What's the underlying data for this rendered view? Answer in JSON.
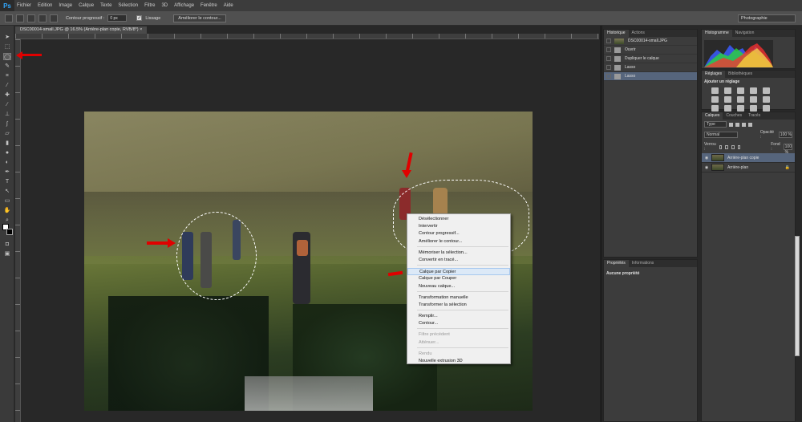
{
  "app": {
    "logo": "Ps"
  },
  "menu": [
    "Fichier",
    "Edition",
    "Image",
    "Calque",
    "Texte",
    "Sélection",
    "Filtre",
    "3D",
    "Affichage",
    "Fenêtre",
    "Aide"
  ],
  "options": {
    "feather_label": "Contour progressif :",
    "feather_value": "0 px",
    "antialias_label": "Lissage",
    "refine_button": "Améliorer le contour...",
    "workspace": "Photographie"
  },
  "document": {
    "tab_title": "DSC00014-small.JPG @ 16.5% (Arrière-plan copie, RVB/8*) ×"
  },
  "context_menu": {
    "items": [
      {
        "label": "Désélectionner",
        "state": "normal"
      },
      {
        "label": "Intervertir",
        "state": "normal"
      },
      {
        "label": "Contour progressif...",
        "state": "normal"
      },
      {
        "label": "Améliorer le contour...",
        "state": "normal"
      },
      {
        "sep": true
      },
      {
        "label": "Mémoriser la sélection...",
        "state": "normal"
      },
      {
        "label": "Convertir en tracé...",
        "state": "normal"
      },
      {
        "sep": true
      },
      {
        "label": "Calque par Copier",
        "state": "highlighted"
      },
      {
        "label": "Calque par Couper",
        "state": "normal"
      },
      {
        "label": "Nouveau calque...",
        "state": "normal"
      },
      {
        "sep": true
      },
      {
        "label": "Transformation manuelle",
        "state": "normal"
      },
      {
        "label": "Transformer la sélection",
        "state": "normal"
      },
      {
        "sep": true
      },
      {
        "label": "Remplir...",
        "state": "normal"
      },
      {
        "label": "Contour...",
        "state": "normal"
      },
      {
        "sep": true
      },
      {
        "label": "Filtre précédent",
        "state": "disabled"
      },
      {
        "label": "Atténuer...",
        "state": "disabled"
      },
      {
        "sep": true
      },
      {
        "label": "Rendu",
        "state": "disabled"
      },
      {
        "label": "Nouvelle extrusion 3D",
        "state": "normal"
      }
    ]
  },
  "history": {
    "tabs": [
      "Historique",
      "Actions"
    ],
    "snapshot": "DSC00014-small.JPG",
    "steps": [
      {
        "label": "Ouvrir",
        "active": false
      },
      {
        "label": "Dupliquer le calque",
        "active": false
      },
      {
        "label": "Lasso",
        "active": false
      },
      {
        "label": "Lasso",
        "active": true
      }
    ]
  },
  "properties": {
    "tabs": [
      "Propriétés",
      "Informations"
    ],
    "text": "Aucune propriété"
  },
  "histogram": {
    "tabs": [
      "Histogramme",
      "Navigation"
    ]
  },
  "adjustments": {
    "tabs": [
      "Réglages",
      "Bibliothèques"
    ],
    "title": "Ajouter un réglage"
  },
  "layers": {
    "tabs": [
      "Calques",
      "Couches",
      "Tracés"
    ],
    "filter": "Type",
    "blend_mode": "Normal",
    "opacity_label": "Opacité :",
    "opacity_value": "100 %",
    "lock_label": "Verrou :",
    "fill_label": "Fond :",
    "fill_value": "100 %",
    "items": [
      {
        "name": "Arrière-plan copie",
        "active": true
      },
      {
        "name": "Arrière-plan",
        "active": false
      }
    ]
  }
}
